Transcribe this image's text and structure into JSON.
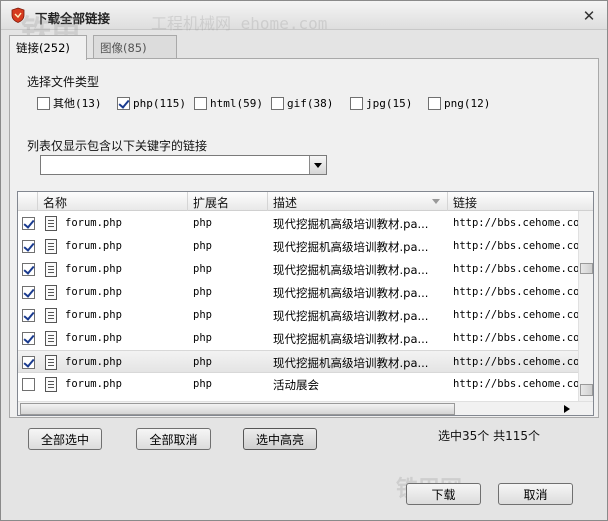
{
  "window": {
    "title": "下载全部链接",
    "close_label": "✕"
  },
  "watermark": {
    "logo": "铁甲",
    "site": "工程机械网",
    "url": "ehome.com",
    "corner": "铁甲网"
  },
  "tabs": [
    {
      "label": "链接(252)",
      "active": true
    },
    {
      "label": "图像(85)",
      "active": false
    }
  ],
  "file_types": {
    "label": "选择文件类型",
    "items": [
      {
        "label": "其他(13)",
        "checked": false
      },
      {
        "label": "php(115)",
        "checked": true
      },
      {
        "label": "html(59)",
        "checked": false
      },
      {
        "label": "gif(38)",
        "checked": false
      },
      {
        "label": "jpg(15)",
        "checked": false
      },
      {
        "label": "png(12)",
        "checked": false
      }
    ]
  },
  "filter": {
    "label": "列表仅显示包含以下关键字的链接",
    "value": ""
  },
  "list": {
    "columns": [
      "名称",
      "扩展名",
      "描述",
      "链接"
    ],
    "rows": [
      {
        "checked": true,
        "name": "forum.php",
        "ext": "php",
        "desc": "现代挖掘机高级培训教材.pa...",
        "link": "http://bbs.cehome.com"
      },
      {
        "checked": true,
        "name": "forum.php",
        "ext": "php",
        "desc": "现代挖掘机高级培训教材.pa...",
        "link": "http://bbs.cehome.com"
      },
      {
        "checked": true,
        "name": "forum.php",
        "ext": "php",
        "desc": "现代挖掘机高级培训教材.pa...",
        "link": "http://bbs.cehome.com"
      },
      {
        "checked": true,
        "name": "forum.php",
        "ext": "php",
        "desc": "现代挖掘机高级培训教材.pa...",
        "link": "http://bbs.cehome.com"
      },
      {
        "checked": true,
        "name": "forum.php",
        "ext": "php",
        "desc": "现代挖掘机高级培训教材.pa...",
        "link": "http://bbs.cehome.com"
      },
      {
        "checked": true,
        "name": "forum.php",
        "ext": "php",
        "desc": "现代挖掘机高级培训教材.pa...",
        "link": "http://bbs.cehome.com"
      },
      {
        "checked": true,
        "name": "forum.php",
        "ext": "php",
        "desc": "现代挖掘机高级培训教材.pa...",
        "link": "http://bbs.cehome.com",
        "selected": true
      },
      {
        "checked": false,
        "name": "forum.php",
        "ext": "php",
        "desc": "活动展会",
        "link": "http://bbs.cehome.com"
      }
    ]
  },
  "buttons": {
    "select_all": "全部选中",
    "clear_all": "全部取消",
    "select_highlight": "选中高亮",
    "download": "下载",
    "cancel": "取消"
  },
  "status": "选中35个 共115个"
}
